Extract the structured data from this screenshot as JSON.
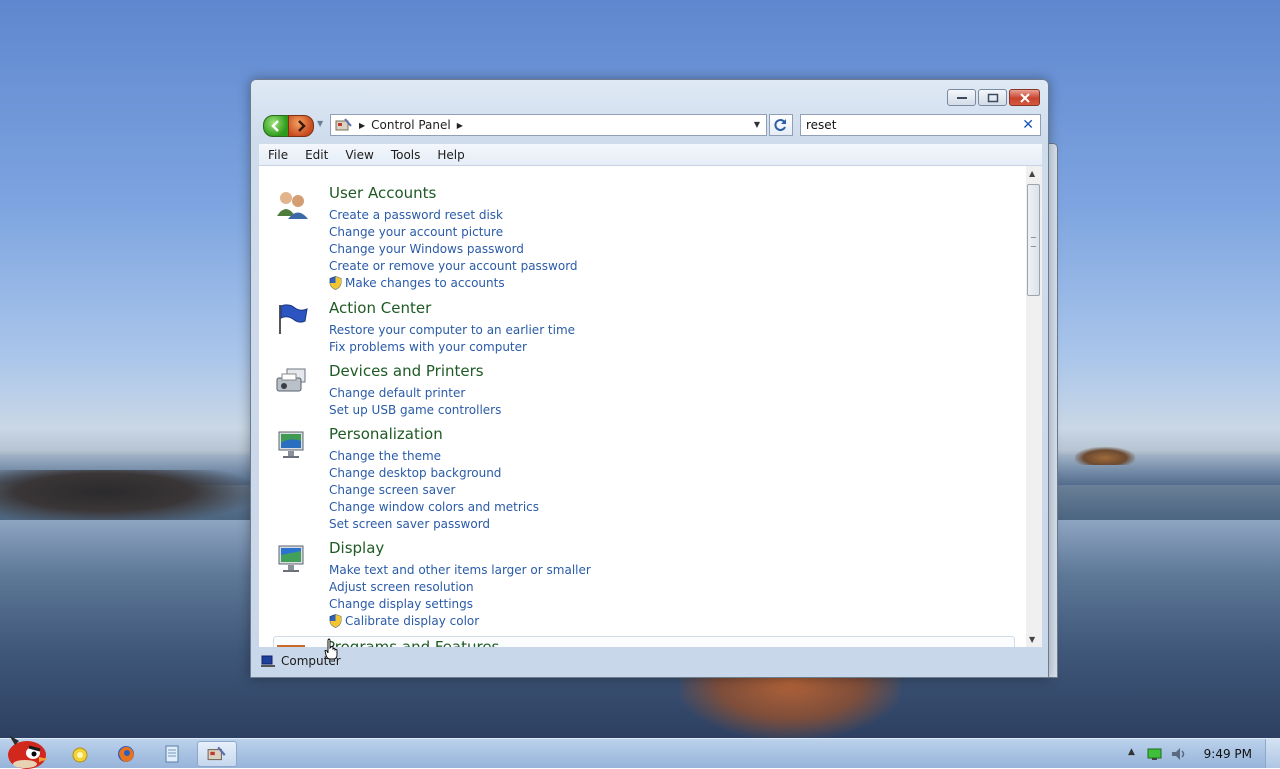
{
  "window": {
    "address": {
      "crumb": "Control Panel"
    },
    "search": {
      "value": "reset"
    },
    "menu": [
      "File",
      "Edit",
      "View",
      "Tools",
      "Help"
    ],
    "statusbar": {
      "text": "Computer"
    }
  },
  "results": [
    {
      "title": "User Accounts",
      "icon": "users-icon",
      "links": [
        {
          "text": "Create a password reset disk",
          "shield": false
        },
        {
          "text": "Change your account picture",
          "shield": false
        },
        {
          "text": "Change your Windows password",
          "shield": false
        },
        {
          "text": "Create or remove your account password",
          "shield": false
        },
        {
          "text": "Make changes to accounts",
          "shield": true
        }
      ]
    },
    {
      "title": "Action Center",
      "icon": "flag-icon",
      "links": [
        {
          "text": "Restore your computer to an earlier time",
          "shield": false
        },
        {
          "text": "Fix problems with your computer",
          "shield": false
        }
      ]
    },
    {
      "title": "Devices and Printers",
      "icon": "printer-icon",
      "links": [
        {
          "text": "Change default printer",
          "shield": false
        },
        {
          "text": "Set up USB game controllers",
          "shield": false
        }
      ]
    },
    {
      "title": "Personalization",
      "icon": "personalization-icon",
      "links": [
        {
          "text": "Change the theme",
          "shield": false
        },
        {
          "text": "Change desktop background",
          "shield": false
        },
        {
          "text": "Change screen saver",
          "shield": false
        },
        {
          "text": "Change window colors and metrics",
          "shield": false
        },
        {
          "text": "Set screen saver password",
          "shield": false
        }
      ]
    },
    {
      "title": "Display",
      "icon": "monitor-icon",
      "links": [
        {
          "text": "Make text and other items larger or smaller",
          "shield": false
        },
        {
          "text": "Adjust screen resolution",
          "shield": false
        },
        {
          "text": "Change display settings",
          "shield": false
        },
        {
          "text": "Calibrate display color",
          "shield": true
        }
      ]
    }
  ],
  "partial_result": {
    "title": "Programs and Features"
  },
  "taskbar": {
    "clock": "9:49 PM",
    "apps": [
      "explorer-icon",
      "firefox-icon",
      "notepad-icon",
      "control-panel-icon"
    ]
  },
  "colors": {
    "link": "#2a5ba8",
    "heading": "#1e5a24"
  }
}
